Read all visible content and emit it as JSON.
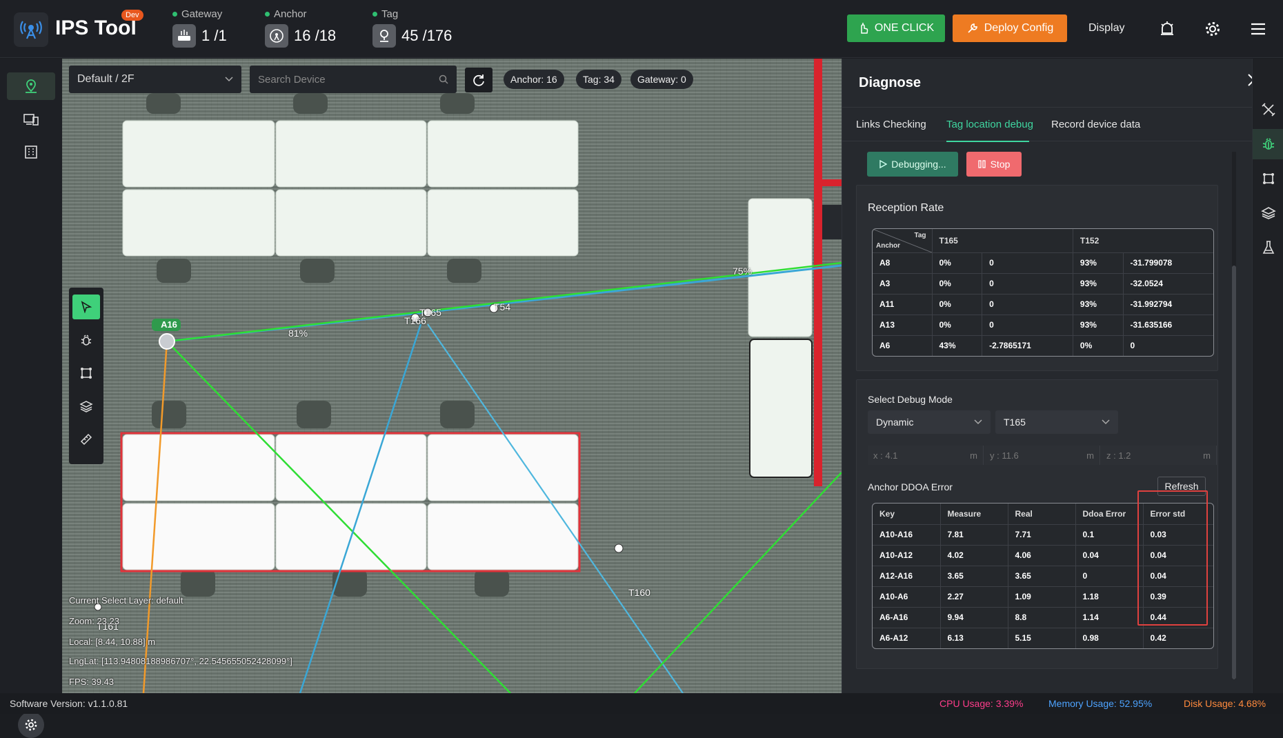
{
  "app": {
    "title": "IPS Tool",
    "badge": "Dev"
  },
  "stats": {
    "gateway": {
      "label": "Gateway",
      "value": "1 /1"
    },
    "anchor": {
      "label": "Anchor",
      "value": "16 /18"
    },
    "tag": {
      "label": "Tag",
      "value": "45 /176"
    }
  },
  "toolbar": {
    "one_click": "ONE CLICK",
    "deploy": "Deploy Config",
    "display": "Display"
  },
  "map": {
    "floor": "Default / 2F",
    "search_placeholder": "Search Device",
    "pills": {
      "anchor": "Anchor: 16",
      "tag": "Tag: 34",
      "gateway": "Gateway: 0"
    },
    "anchor_label": "A16",
    "percent_labels": {
      "a16_link": "81%",
      "right_link": "75%"
    },
    "tags": {
      "t165": "T165",
      "t166": "T166",
      "t54": "T54",
      "t160": "T160",
      "t161": "T161"
    },
    "info": {
      "layer": "Current Select Layer:  default",
      "zoom": "Zoom:  23.23",
      "local": "Local:  [8.44,  10.88] m",
      "lnglat": "LngLat:  [113.94808188986707°,  22.545655052428099°]",
      "fps": "FPS:  39.43"
    }
  },
  "panel": {
    "title": "Diagnose",
    "tabs": [
      "Links Checking",
      "Tag location debug",
      "Record device data"
    ],
    "debugging": "Debugging...",
    "stop": "Stop",
    "reception": {
      "title": "Reception Rate",
      "corner_tag": "Tag",
      "corner_anchor": "Anchor",
      "headers": [
        "T165",
        "T152"
      ],
      "rows": [
        [
          "A8",
          "0%",
          "0",
          "93%",
          "-31.799078"
        ],
        [
          "A3",
          "0%",
          "0",
          "93%",
          "-32.0524"
        ],
        [
          "A11",
          "0%",
          "0",
          "93%",
          "-31.992794"
        ],
        [
          "A13",
          "0%",
          "0",
          "93%",
          "-31.635166"
        ],
        [
          "A6",
          "43%",
          "-2.7865171",
          "0%",
          "0"
        ]
      ]
    },
    "debug_mode": {
      "title": "Select Debug Mode",
      "mode": "Dynamic",
      "tag": "T165",
      "x": "x : 4.1",
      "y": "y : 11.6",
      "z": "z : 1.2",
      "unit": "m"
    },
    "ddoa": {
      "title": "Anchor DDOA Error",
      "refresh": "Refresh",
      "headers": [
        "Key",
        "Measure",
        "Real",
        "Ddoa Error",
        "Error std"
      ],
      "rows": [
        [
          "A10-A16",
          "7.81",
          "7.71",
          "0.1",
          "0.03"
        ],
        [
          "A10-A12",
          "4.02",
          "4.06",
          "0.04",
          "0.04"
        ],
        [
          "A12-A16",
          "3.65",
          "3.65",
          "0",
          "0.04"
        ],
        [
          "A10-A6",
          "2.27",
          "1.09",
          "1.18",
          "0.39"
        ],
        [
          "A6-A16",
          "9.94",
          "8.8",
          "1.14",
          "0.44"
        ],
        [
          "A6-A12",
          "6.13",
          "5.15",
          "0.98",
          "0.42"
        ]
      ]
    }
  },
  "status": {
    "version": "Software Version:  v1.1.0.81",
    "cpu": "CPU Usage:  3.39%",
    "memory": "Memory Usage:  52.95%",
    "disk": "Disk Usage:  4.68%",
    "colors": {
      "cpu": "#ff3d8b",
      "memory": "#4da3ff",
      "disk": "#ff8a3d"
    }
  }
}
